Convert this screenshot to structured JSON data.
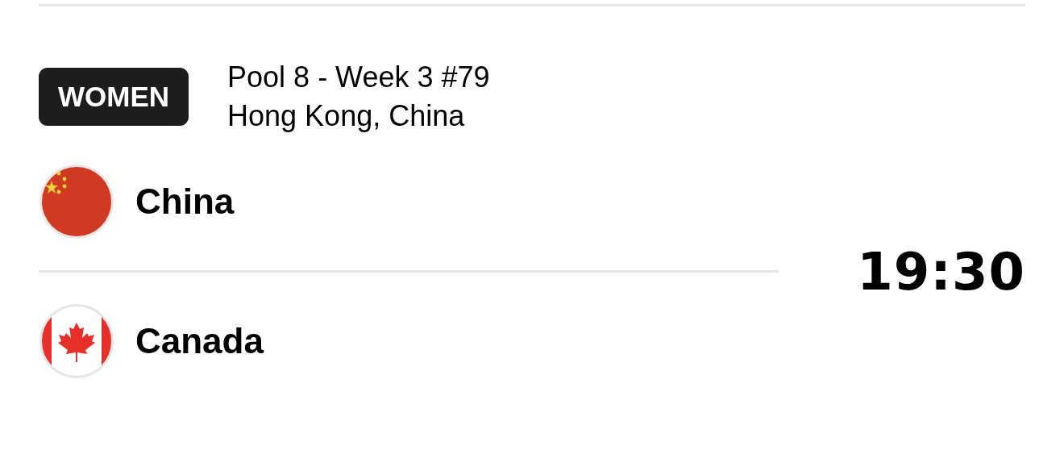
{
  "match": {
    "category": "WOMEN",
    "title": "Pool 8 - Week 3 #79",
    "venue": "Hong Kong, China",
    "time": "19:30"
  },
  "teams": [
    {
      "name": "China"
    },
    {
      "name": "Canada"
    }
  ]
}
